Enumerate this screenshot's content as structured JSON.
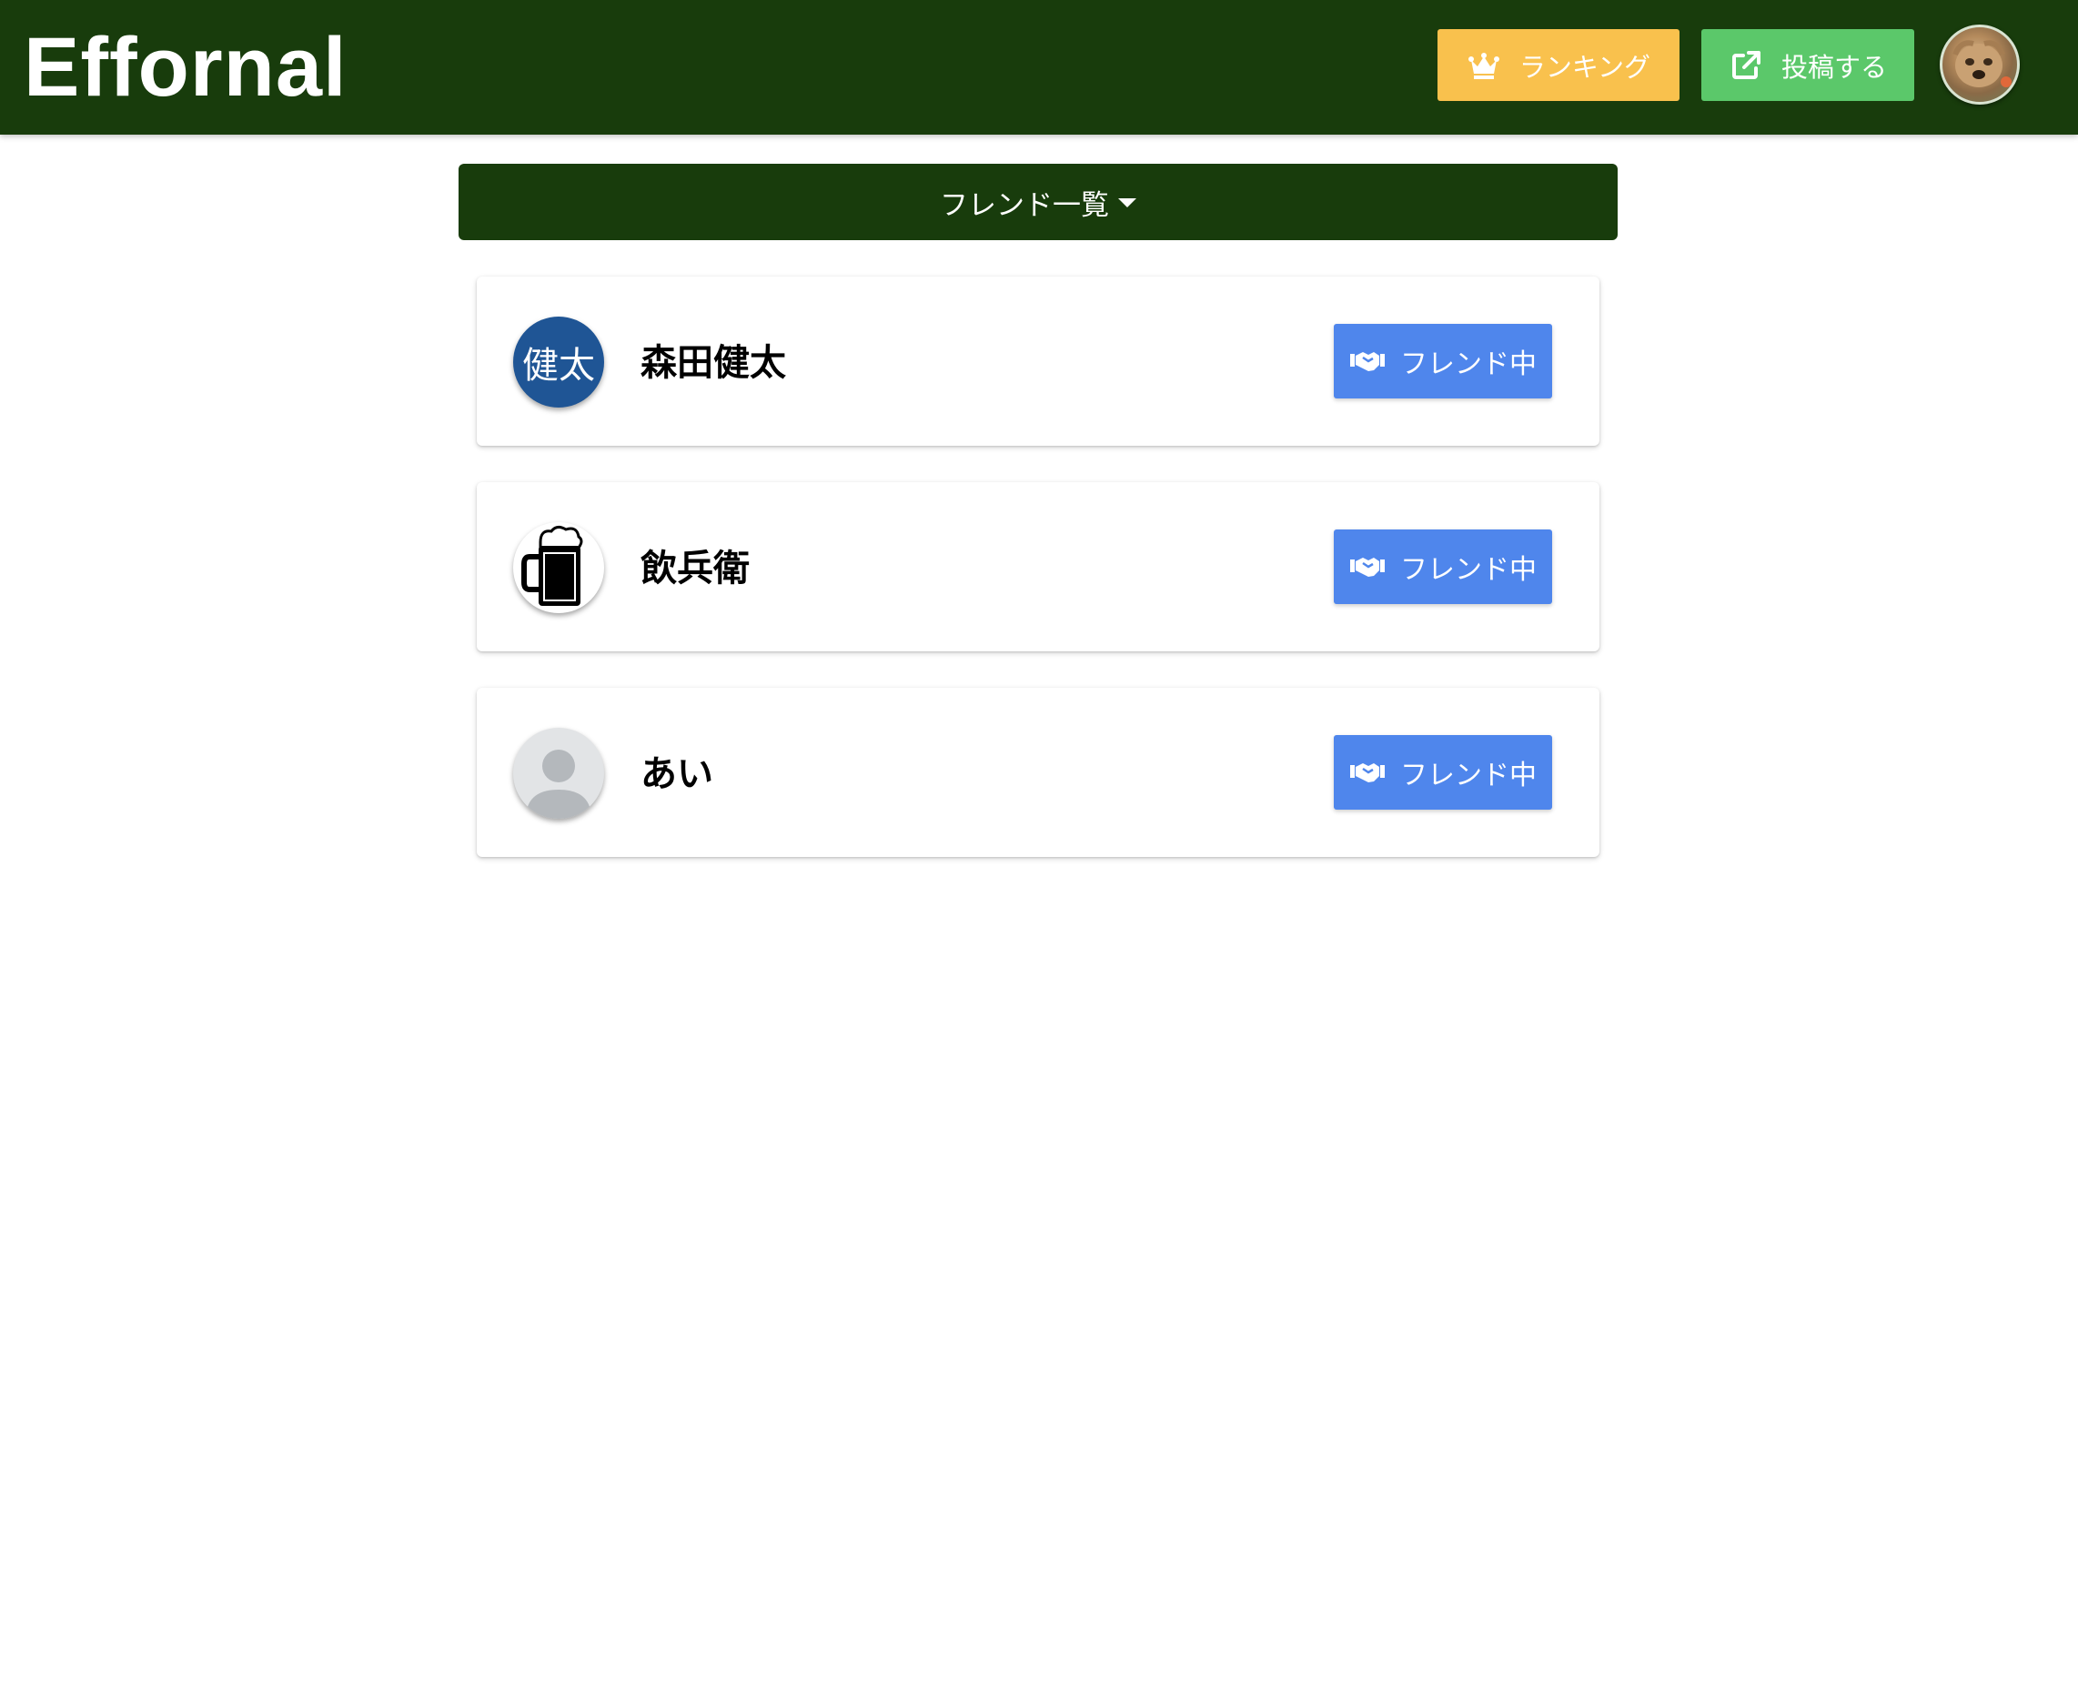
{
  "header": {
    "brand": "Effornal",
    "ranking_label": "ランキング",
    "ranking_icon": "crown-icon",
    "ranking_color": "#f9c14d",
    "post_label": "投稿する",
    "post_icon": "external-link-icon",
    "post_color": "#5bc86a",
    "bar_color": "#183c0c"
  },
  "dropdown": {
    "label": "フレンド一覧"
  },
  "friends": [
    {
      "name": "森田健太",
      "avatar_text": "健太",
      "avatar_type": "kanji",
      "button_label": "フレンド中"
    },
    {
      "name": "飲兵衛",
      "avatar_type": "beer-mug",
      "button_label": "フレンド中"
    },
    {
      "name": "あい",
      "avatar_type": "default-user",
      "button_label": "フレンド中"
    }
  ],
  "colors": {
    "friend_button": "#4f86ec",
    "kanji_avatar": "#1f5595"
  }
}
